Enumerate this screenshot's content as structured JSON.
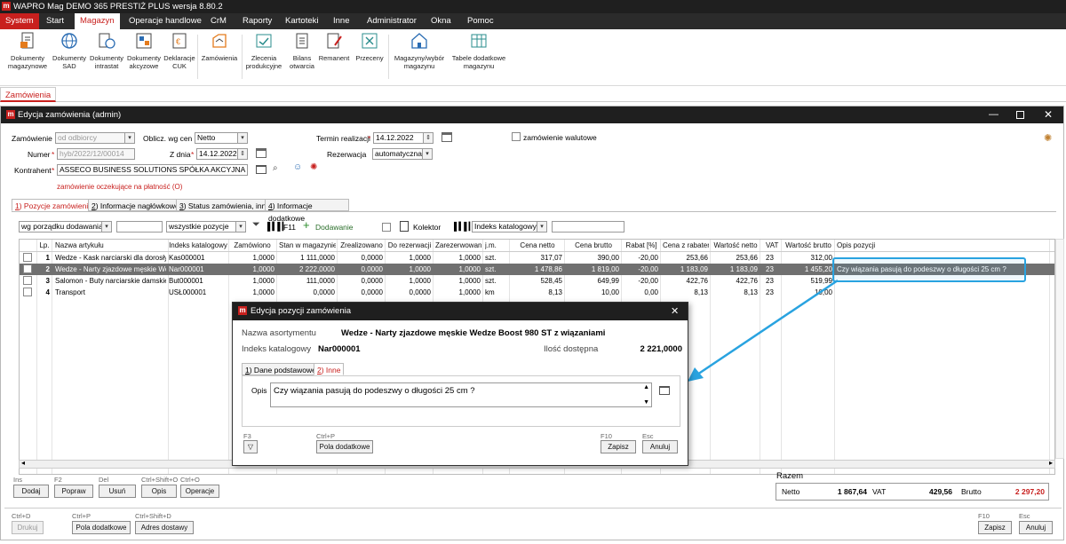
{
  "app": {
    "title": "WAPRO Mag DEMO 365 PRESTIŻ PLUS  wersja 8.80.2"
  },
  "menu": {
    "system": "System",
    "items": [
      "Start",
      "Magazyn",
      "Operacje handlowe",
      "CrM",
      "Raporty",
      "Kartoteki",
      "Inne",
      "Administrator",
      "Okna",
      "Pomoc"
    ],
    "active": "Magazyn"
  },
  "ribbon": {
    "items": [
      {
        "label1": "Dokumenty",
        "label2": "magazynowe",
        "icon": "document-icon"
      },
      {
        "label1": "Dokumenty",
        "label2": "SAD",
        "icon": "globe-icon"
      },
      {
        "label1": "Dokumenty",
        "label2": "intrastat",
        "icon": "document-globe-icon"
      },
      {
        "label1": "Dokumenty",
        "label2": "akcyzowe",
        "icon": "excise-icon"
      },
      {
        "label1": "Deklaracje",
        "label2": "CUK",
        "icon": "declaration-icon"
      },
      {
        "label1": "Zamówienia",
        "label2": "",
        "icon": "order-icon"
      },
      {
        "label1": "Zlecenia",
        "label2": "produkcyjne",
        "icon": "production-icon"
      },
      {
        "label1": "Bilans",
        "label2": "otwarcia",
        "icon": "balance-icon"
      },
      {
        "label1": "Remanent",
        "label2": "",
        "icon": "inventory-icon"
      },
      {
        "label1": "Przeceny",
        "label2": "",
        "icon": "reprice-icon"
      },
      {
        "label1": "Magazyny/wybór",
        "label2": "magazynu",
        "icon": "warehouse-icon"
      },
      {
        "label1": "Tabele dodatkowe",
        "label2": "magazynu",
        "icon": "table-icon"
      }
    ]
  },
  "doc_tab": "Zamówienia",
  "window": {
    "title": "Edycja zamówienia (admin)"
  },
  "form": {
    "zamowienie_label": "Zamówienie",
    "zamowienie_value": "od odbiorcy",
    "oblicz_label": "Oblicz. wg cen",
    "oblicz_value": "Netto",
    "termin_label": "Termin realizacji",
    "termin_value": "14.12.2022",
    "walutowe_label": "zamówienie walutowe",
    "numer_label": "Numer",
    "numer_value": "hyb/2022/12/00014",
    "zdnia_label": "Z dnia",
    "zdnia_value": "14.12.2022",
    "rezerwacja_label": "Rezerwacja",
    "rezerwacja_value": "automatyczna",
    "kontrahent_label": "Kontrahent",
    "kontrahent_value": "ASSECO BUSINESS SOLUTIONS SPÓŁKA AKCYJNA",
    "pending_note": "zamówienie oczekujące na płatność (O)"
  },
  "tabs": [
    {
      "key": "1",
      "label": ") Pozycje zamówienia"
    },
    {
      "key": "2",
      "label": ") Informacje nagłówkowe"
    },
    {
      "key": "3",
      "label": ") Status zamówienia, inne"
    },
    {
      "key": "4",
      "label": ") Informacje dodatkowe"
    }
  ],
  "toolbar": {
    "sort_value": "wg porządku dodawania",
    "filter_value": "wszystkie pozycje",
    "f11": "F11",
    "add": "Dodawanie",
    "kolektor": "Kolektor",
    "index_value": "Indeks katalogowy"
  },
  "table": {
    "headers": [
      "Lp.",
      "Nazwa artykułu",
      "Indeks katalogowy",
      "Zamówiono",
      "Stan w magazynie",
      "Zrealizowano",
      "Do rezerwacji",
      "Zarezerwowane",
      "j.m.",
      "Cena netto",
      "Cena brutto",
      "Rabat [%]",
      "Cena z rabatem",
      "Wartość netto",
      "VAT",
      "Wartość brutto",
      "Opis pozycji"
    ],
    "rows": [
      [
        "1",
        "Wedze - Kask narciarski dla dorosłych",
        "Kas000001",
        "1,0000",
        "1 111,0000",
        "0,0000",
        "1,0000",
        "1,0000",
        "szt.",
        "317,07",
        "390,00",
        "-20,00",
        "253,66",
        "253,66",
        "23",
        "312,00",
        ""
      ],
      [
        "2",
        "Wedze - Narty zjazdowe męskie Wedze",
        "Nar000001",
        "1,0000",
        "2 222,0000",
        "0,0000",
        "1,0000",
        "1,0000",
        "szt.",
        "1 478,86",
        "1 819,00",
        "-20,00",
        "1 183,09",
        "1 183,09",
        "23",
        "1 455,20",
        "Czy wiązania pasują do podeszwy o długości 25 cm ?"
      ],
      [
        "3",
        "Salomon - Buty narciarskie damskie S",
        "But000001",
        "1,0000",
        "111,0000",
        "0,0000",
        "1,0000",
        "1,0000",
        "szt.",
        "528,45",
        "649,99",
        "-20,00",
        "422,76",
        "422,76",
        "23",
        "519,99",
        ""
      ],
      [
        "4",
        "Transport",
        "USŁ000001",
        "1,0000",
        "0,0000",
        "0,0000",
        "0,0000",
        "1,0000",
        "km",
        "8,13",
        "10,00",
        "0,00",
        "8,13",
        "8,13",
        "23",
        "10,00",
        ""
      ]
    ],
    "selected_row": 2
  },
  "bottom_buttons": [
    {
      "hint": "Ins",
      "label": "Dodaj"
    },
    {
      "hint": "F2",
      "label": "Popraw"
    },
    {
      "hint": "Del",
      "label": "Usuń"
    },
    {
      "hint": "Ctrl+Shift+O",
      "label": "Opis"
    },
    {
      "hint": "Ctrl+O",
      "label": "Operacje"
    }
  ],
  "footer_buttons": [
    {
      "hint": "Ctrl+D",
      "label": "Drukuj"
    },
    {
      "hint": "Ctrl+P",
      "label": "Pola dodatkowe"
    },
    {
      "hint": "Ctrl+Shift+D",
      "label": "Adres dostawy"
    }
  ],
  "totals": {
    "title": "Razem",
    "netto_label": "Netto",
    "netto": "1 867,64",
    "vat_label": "VAT",
    "vat": "429,56",
    "brutto_label": "Brutto",
    "brutto": "2 297,20"
  },
  "main_actions": {
    "save_hint": "F10",
    "save": "Zapisz",
    "cancel_hint": "Esc",
    "cancel": "Anuluj"
  },
  "dialog": {
    "title": "Edycja pozycji zamówienia",
    "name_label": "Nazwa asortymentu",
    "name_value": "Wedze - Narty zjazdowe męskie Wedze Boost 980 ST z wiązaniami",
    "index_label": "Indeks katalogowy",
    "index_value": "Nar000001",
    "qty_label": "Ilość dostępna",
    "qty_value": "2 221,0000",
    "tab1": ") Dane podstawowe",
    "tab2": ") Inne",
    "opis_label": "Opis",
    "opis_value": "Czy wiązania pasują do podeszwy o długości 25 cm ?",
    "f3": "F3",
    "ctrlp": "Ctrl+P",
    "pola": "Pola dodatkowe",
    "f10": "F10",
    "zapisz": "Zapisz",
    "esc": "Esc",
    "anuluj": "Anuluj"
  },
  "colors": {
    "accent": "#c8201e",
    "titlebar": "#1f1f1f",
    "selected_row": "#707070",
    "callout": "#29a3e0"
  }
}
